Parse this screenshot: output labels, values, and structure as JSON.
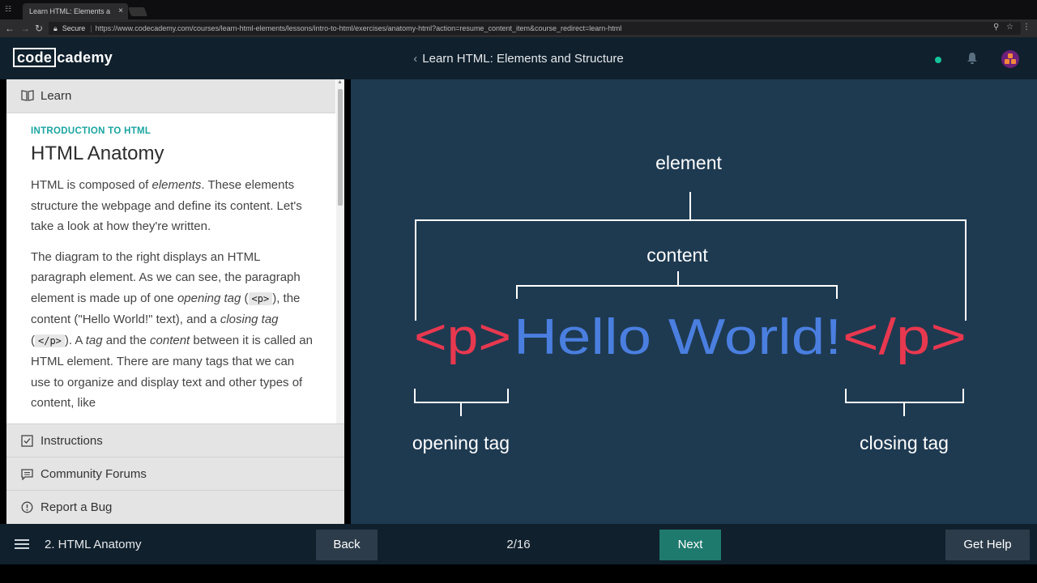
{
  "browser": {
    "tab_title": "Learn HTML: Elements a",
    "secure_label": "Secure",
    "url": "https://www.codecademy.com/courses/learn-html-elements/lessons/intro-to-html/exercises/anatomy-html?action=resume_content_item&course_redirect=learn-html"
  },
  "header": {
    "logo_part1": "code",
    "logo_part2": "cademy",
    "course_title": "Learn HTML: Elements and Structure",
    "status_color": "#15c39a"
  },
  "left_panel": {
    "learn_tab": "Learn",
    "eyebrow": "INTRODUCTION TO HTML",
    "title": "HTML Anatomy",
    "p1": {
      "a": "HTML is composed of ",
      "b": "elements",
      "c": ". These elements structure the webpage and define its content. Let's take a look at how they're written."
    },
    "p2": {
      "a": "The diagram to the right displays an HTML paragraph element. As we can see, the paragraph element is made up of one ",
      "b": "opening tag",
      "c": " (",
      "code1": "<p>",
      "d": "), the content (\"Hello World!\" text), and a ",
      "e": "closing tag",
      "f": " (",
      "code2": "</p>",
      "g": "). A ",
      "h": "tag",
      "i": " and the ",
      "j": "content",
      "k": " between it is called an HTML element. There are many tags that we can use to organize and display text and other types of content, like"
    },
    "instructions": "Instructions",
    "forums": "Community Forums",
    "bug": "Report a Bug"
  },
  "diagram": {
    "element_label": "element",
    "content_label": "content",
    "open_tag": "<p>",
    "hello": "Hello World!",
    "close_tag": "</p>",
    "opening_label": "opening tag",
    "closing_label": "closing tag",
    "tag_color": "#e8384f",
    "content_color": "#4a7fe0",
    "bg_color": "#1e3a51"
  },
  "footer": {
    "lesson": "2. HTML Anatomy",
    "back": "Back",
    "progress": "2/16",
    "next": "Next",
    "help": "Get Help"
  }
}
